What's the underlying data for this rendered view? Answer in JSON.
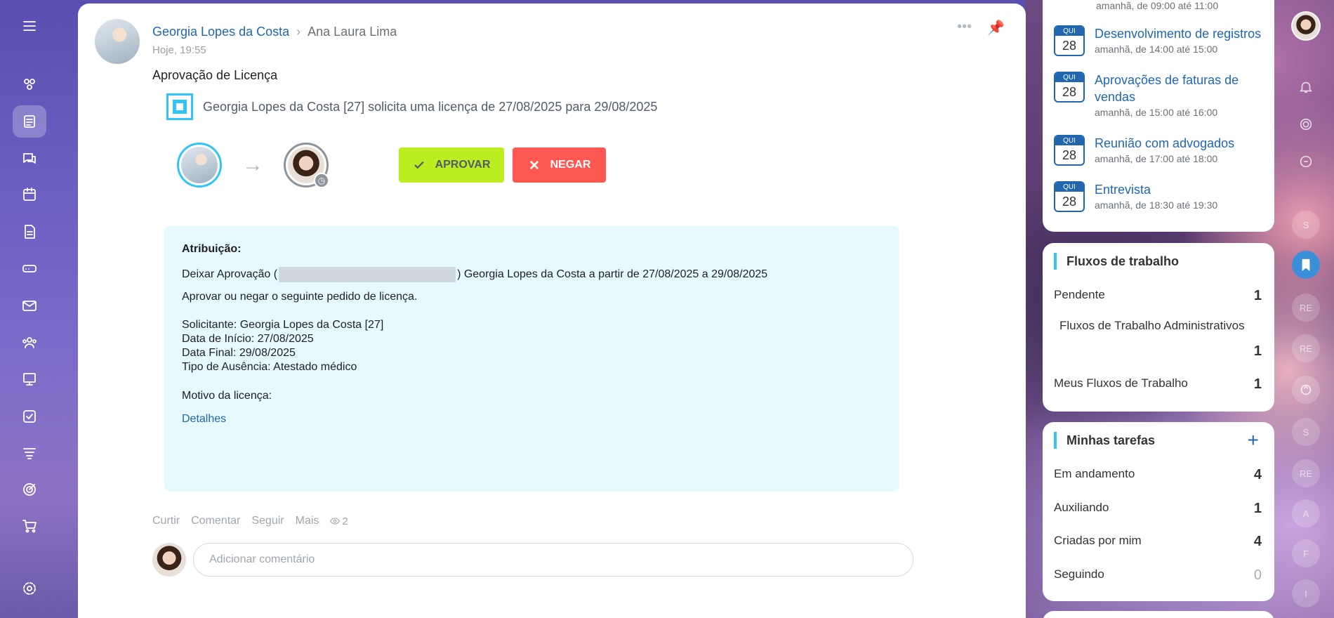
{
  "post": {
    "author": "Georgia Lopes da Costa",
    "recipient": "Ana Laura Lima",
    "time": "Hoje, 19:55",
    "title": "Aprovação de Licença",
    "request_text": "Georgia Lopes da Costa [27] solicita uma licença de 27/08/2025 para 29/08/2025",
    "approve_label": "APROVAR",
    "deny_label": "NEGAR",
    "info": {
      "heading": "Atribuição:",
      "line1_prefix": "Deixar Aprovação (",
      "line1_suffix": ") Georgia Lopes da Costa a partir de 27/08/2025 a 29/08/2025",
      "line2": "Aprovar ou negar o seguinte pedido de licença.",
      "requester": "Solicitante: Georgia Lopes da Costa [27]",
      "start": "Data de Início: 27/08/2025",
      "end": "Data Final: 29/08/2025",
      "absence_type": "Tipo de Ausência: Atestado médico",
      "reason": "Motivo da licença:",
      "details": "Detalhes"
    },
    "actions": {
      "like": "Curtir",
      "comment": "Comentar",
      "follow": "Seguir",
      "more": "Mais",
      "views": "2"
    },
    "comment_placeholder": "Adicionar comentário"
  },
  "calendar": {
    "top_time": "amanhã, de 09:00 até 11:00",
    "items": [
      {
        "day": "QUI",
        "num": "28",
        "title": "Desenvolvimento de registros",
        "time": "amanhã, de 14:00 até 15:00"
      },
      {
        "day": "QUI",
        "num": "28",
        "title": "Aprovações de faturas de vendas",
        "time": "amanhã, de 15:00 até 16:00"
      },
      {
        "day": "QUI",
        "num": "28",
        "title": "Reunião com advogados",
        "time": "amanhã, de 17:00 até 18:00"
      },
      {
        "day": "QUI",
        "num": "28",
        "title": "Entrevista",
        "time": "amanhã, de 18:30 até 19:30"
      }
    ]
  },
  "workflows": {
    "title": "Fluxos de trabalho",
    "pending_label": "Pendente",
    "pending_count": "1",
    "admin_label": "Fluxos de Trabalho Administrativos",
    "admin_count": "1",
    "mine_label": "Meus Fluxos de Trabalho",
    "mine_count": "1"
  },
  "tasks": {
    "title": "Minhas tarefas",
    "in_progress_label": "Em andamento",
    "in_progress_count": "4",
    "assisting_label": "Auxiliando",
    "assisting_count": "1",
    "created_label": "Criadas por mim",
    "created_count": "4",
    "following_label": "Seguindo",
    "following_count": "0"
  },
  "rail": {
    "letters": [
      "S",
      "RE",
      "RE",
      "S",
      "RE",
      "A",
      "F",
      "I"
    ]
  }
}
